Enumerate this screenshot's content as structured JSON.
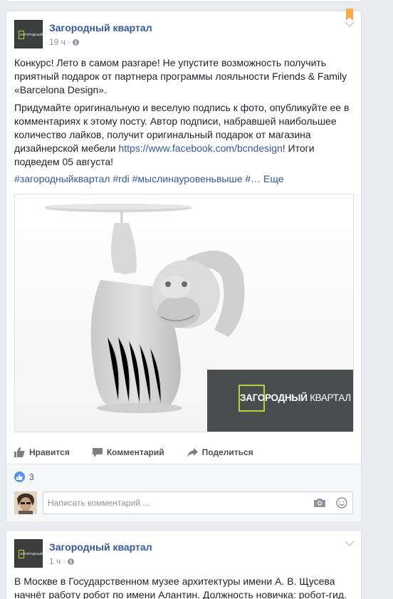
{
  "post1": {
    "page_name": "Загородный квартал",
    "time": "19 ч",
    "meta_sep": "·",
    "logo_text": "ЗАГОРОДНЫЙ КВАРТАЛ",
    "paragraph1": "Конкурс! Лето в самом разгаре! Не упустите возможность получить приятный подарок от партнера программы лояльности Friends & Family «Barcelona Design».",
    "paragraph2_before_link": "Придумайте оригинальную и веселую подпись к фото, опубликуйте ее в комментариях к этому посту. Автор подписи, набравшей наибольшее количество лайков, получит оригинальный подарок от магазина дизайнерской мебели ",
    "paragraph2_link": "https://www.facebook.com/bcndesign",
    "paragraph2_after_link": "! Итоги подведем 05 августа!",
    "hashtags": "#загородныйквартал #rdi #мыслинауровеньвыше #… Еще",
    "photo_brand": {
      "text_bold": "ЗАГОРОДНЫЙ",
      "text_light": " КВАРТАЛ"
    },
    "actions": {
      "like": "Нравится",
      "comment": "Комментарий",
      "share": "Поделиться"
    },
    "like_count": "3",
    "comment_placeholder": "Написать комментарий ..."
  },
  "post2": {
    "page_name": "Загородный квартал",
    "time": "1 ч",
    "meta_sep": "·",
    "logo_text": "ЗАГОРОДНЫЙ КВАРТАЛ",
    "text": "В Москве в Государственном музее архитектуры имени А. В. Щусева начнёт работу робот по имени Алантин. Должность новичка: робот-гид."
  },
  "colors": {
    "link": "#365899",
    "background": "#e9ebee",
    "accent_green": "#b9cf3a",
    "bookmark": "#f7a94b",
    "like_blue": "#5890ff"
  },
  "icons": [
    "globe-icon",
    "chevron-down-icon",
    "bookmark-icon",
    "thumbs-up-icon",
    "comment-icon",
    "share-icon",
    "camera-icon",
    "smiley-icon"
  ]
}
